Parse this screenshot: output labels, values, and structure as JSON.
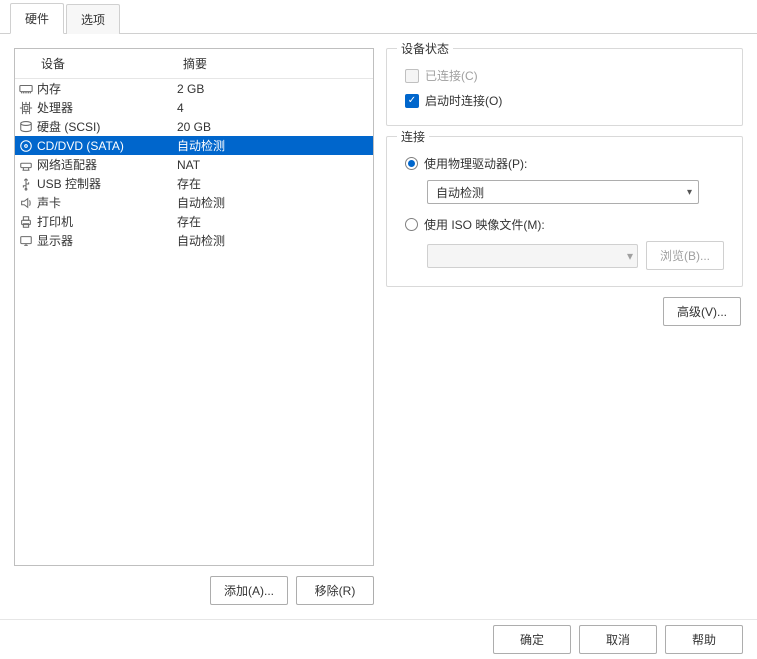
{
  "tabs": {
    "hardware": "硬件",
    "options": "选项"
  },
  "table": {
    "header_device": "设备",
    "header_summary": "摘要",
    "rows": [
      {
        "icon": "memory-icon",
        "device": "内存",
        "summary": "2 GB"
      },
      {
        "icon": "cpu-icon",
        "device": "处理器",
        "summary": "4"
      },
      {
        "icon": "disk-icon",
        "device": "硬盘 (SCSI)",
        "summary": "20 GB"
      },
      {
        "icon": "disc-icon",
        "device": "CD/DVD (SATA)",
        "summary": "自动检测"
      },
      {
        "icon": "network-icon",
        "device": "网络适配器",
        "summary": "NAT"
      },
      {
        "icon": "usb-icon",
        "device": "USB 控制器",
        "summary": "存在"
      },
      {
        "icon": "sound-icon",
        "device": "声卡",
        "summary": "自动检测"
      },
      {
        "icon": "printer-icon",
        "device": "打印机",
        "summary": "存在"
      },
      {
        "icon": "display-icon",
        "device": "显示器",
        "summary": "自动检测"
      }
    ],
    "selected_index": 3
  },
  "left_buttons": {
    "add": "添加(A)...",
    "remove": "移除(R)"
  },
  "status_group": {
    "title": "设备状态",
    "connected": "已连接(C)",
    "connect_at_poweron": "启动时连接(O)"
  },
  "connection_group": {
    "title": "连接",
    "use_physical": "使用物理驱动器(P):",
    "physical_value": "自动检测",
    "use_iso": "使用 ISO 映像文件(M):",
    "browse": "浏览(B)..."
  },
  "advanced": "高级(V)...",
  "bottom": {
    "ok": "确定",
    "cancel": "取消",
    "help": "帮助"
  }
}
